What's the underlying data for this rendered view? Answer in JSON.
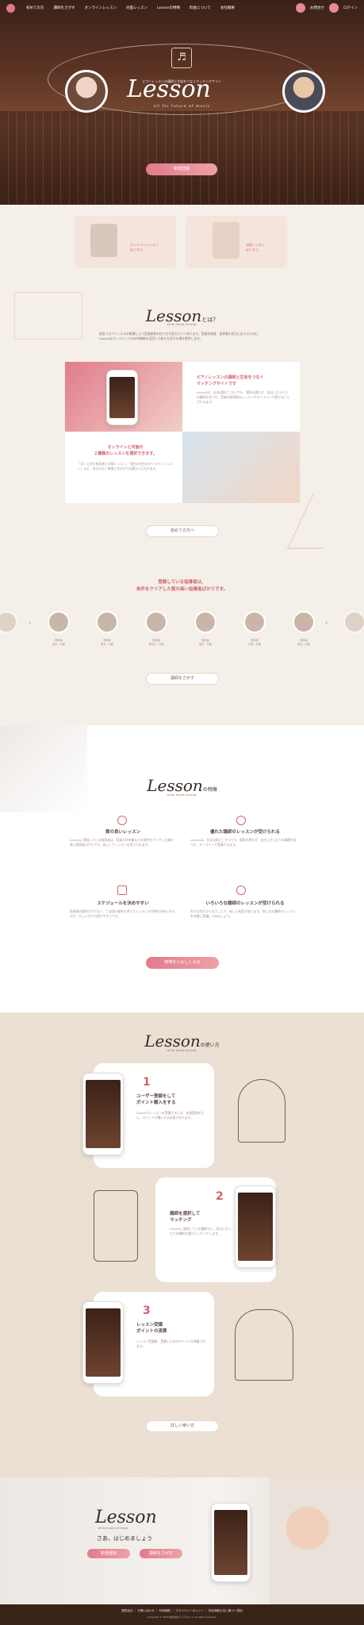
{
  "nav": {
    "items": [
      "初めての方",
      "講師をさがす",
      "オンラインレッスン",
      "対面レッスン",
      "Lessonの特徴",
      "料金について",
      "会社概要"
    ],
    "contact_label": "お問合せ",
    "login_label": "ログイン"
  },
  "hero": {
    "tagline": "ピアノレッスンの講師と生徒をつなぐマッチングサイト",
    "logo": "Lesson",
    "logo_sub": "all for future of music",
    "cta": "新規登録"
  },
  "tiles": {
    "online": "オンラインレッスン\nはこちら",
    "face": "対面レッスン\nはこちら"
  },
  "about": {
    "logo": "Lesson",
    "logo_suffix": "とは？",
    "logo_sub": "all for future of music",
    "intro": "新型コロナウィルスの影響により音楽教育の在り方が変わりつつあります。音楽学習者、指導者の双方に応えるために、LessonはオンラインとSNS的機能を活用した新たな学びの場を提供します。",
    "block1_title": "ピアノレッスンの講師と生徒をつなぐ\nマッチングサイトです",
    "block1_text": "Lessonは、日本全国どこからでも、場所を問わず、自分にぴったりの講師を見つけ、音楽の指導者をレッスンやオンラインで受けることができます。",
    "block2_title": "オンラインと対面の\n２種類のレッスンを選択できます。",
    "block2_text": "「近くに住む指導者と対面レッスン」「遠方の先生のオンラインレッスン」など、あなたのご希望に合わせてお選びいただけます。",
    "cta": "初めての方へ"
  },
  "teachers": {
    "heading": "登録している指導者は、\n条件をクリアした質の高い指導者ばかりです。",
    "items": [
      {
        "name": "指導者",
        "meta": "東京・対面"
      },
      {
        "name": "指導者",
        "meta": "東京・対面"
      },
      {
        "name": "指導者",
        "meta": "神奈川・対面"
      },
      {
        "name": "指導者",
        "meta": "東京・対面"
      },
      {
        "name": "指導者",
        "meta": "大阪・対面"
      },
      {
        "name": "指導者",
        "meta": "東京・対面"
      },
      {
        "name": "指導者",
        "meta": "東京・対面"
      },
      {
        "name": "指導者",
        "meta": "東京・対面"
      }
    ],
    "cta": "講師をさがす"
  },
  "features": {
    "logo": "Lesson",
    "logo_suffix": "の特徴",
    "logo_sub": "all for future of music",
    "items": [
      {
        "title": "質の良いレッスン",
        "text": "Lessonに登録している指導者は、音楽大学卒業などの条件をクリアした質の高い指導者ばかりです。安心してレッスンを受けられます。"
      },
      {
        "title": "優れた講師のレッスンが受けられる",
        "text": "Lessonは、日本全国どこからでも、場所を問わず、自分にぴったりの講師を見つけ、オンラインで受講できます。"
      },
      {
        "title": "スケジュールを決めやすい",
        "text": "指導者の都合だけでなく、ご自身の都合も考えてレッスンの日時を決められるので、忙しい方でも続けやすいです。"
      },
      {
        "title": "いろいろな講師のレッスンが受けられる",
        "text": "色々な先生から学ぶことで、新しい発見があります。気になる講師のレッスンを気軽に受講してみましょう。"
      }
    ],
    "cta": "特徴をくわしくみる"
  },
  "howto": {
    "logo": "Lesson",
    "logo_suffix": "の使い方",
    "logo_sub": "all for future of music",
    "steps": [
      {
        "num": "1",
        "title": "ユーザー登録をして\nポイント購入をする",
        "text": "Lessonでレッスンを受講するには、会員登録を行い、ポイントを購入する必要があります。"
      },
      {
        "num": "2",
        "title": "講師を選択して\nマッチング",
        "text": "Lessonに登録している講師から、自分にぴったりの講師を選びマッチングします。"
      },
      {
        "num": "3",
        "title": "レッスン受講\nポイントの清算",
        "text": "レッスン受講後、受講した分のポイントが清算されます。"
      }
    ],
    "cta": "詳しい使い方"
  },
  "closing": {
    "logo": "Lesson",
    "logo_sub": "all for future of music",
    "tagline": "さあ、はじめましょう",
    "cta1": "新規登録",
    "cta2": "講師をさがす"
  },
  "footer": {
    "links": "運営会社 ｜ お問い合わせ ｜ 利用規約 ｜ プライバシーポリシー ｜ 特定商取引法に基づく表記",
    "copyright": "Copyright © 2020 株式会社アトラネット All rights reserved."
  },
  "colors": {
    "accent": "#e07a8a",
    "brown": "#3a2418",
    "cream": "#f4efe8"
  }
}
